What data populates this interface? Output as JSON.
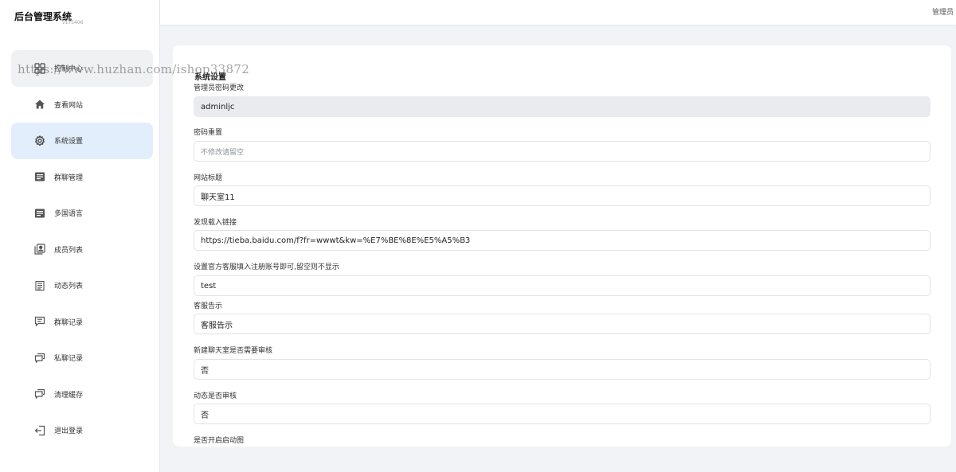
{
  "brand": {
    "title": "后台管理系统",
    "version": "v175406"
  },
  "watermark": "https://www.huzhan.com/ishop33872",
  "topbar": {
    "user": "管理员"
  },
  "sidebar": {
    "items": [
      {
        "label": "控制中心",
        "icon": "grid-icon"
      },
      {
        "label": "查看网站",
        "icon": "home-icon"
      },
      {
        "label": "系统设置",
        "icon": "gear-icon"
      },
      {
        "label": "群聊管理",
        "icon": "list-icon"
      },
      {
        "label": "多国语言",
        "icon": "list-icon"
      },
      {
        "label": "成员列表",
        "icon": "contacts-icon"
      },
      {
        "label": "动态列表",
        "icon": "document-icon"
      },
      {
        "label": "群聊记录",
        "icon": "message-icon"
      },
      {
        "label": "私聊记录",
        "icon": "chat-icon"
      },
      {
        "label": "清理缓存",
        "icon": "chat-icon"
      },
      {
        "label": "退出登录",
        "icon": "logout-icon"
      }
    ]
  },
  "settings": {
    "title": "系统设置",
    "fields": [
      {
        "label": "管理员密码更改",
        "value": "adminljc"
      },
      {
        "label": "密码重置",
        "placeholder": "不修改请留空"
      },
      {
        "label": "网站标题",
        "value": "聊天室11"
      },
      {
        "label": "发现载入链接",
        "value": "https://tieba.baidu.com/f?fr=wwwt&kw=%E7%BE%8E%E5%A5%B3"
      },
      {
        "label": "设置官方客服填入注册账号即可,留空则不显示",
        "value": "test"
      },
      {
        "label": "客服告示",
        "value": "客服告示"
      },
      {
        "label": "新建聊天室是否需要审核",
        "value": "否"
      },
      {
        "label": "动态是否审核",
        "value": "否"
      },
      {
        "label": "是否开启启动图"
      }
    ]
  }
}
